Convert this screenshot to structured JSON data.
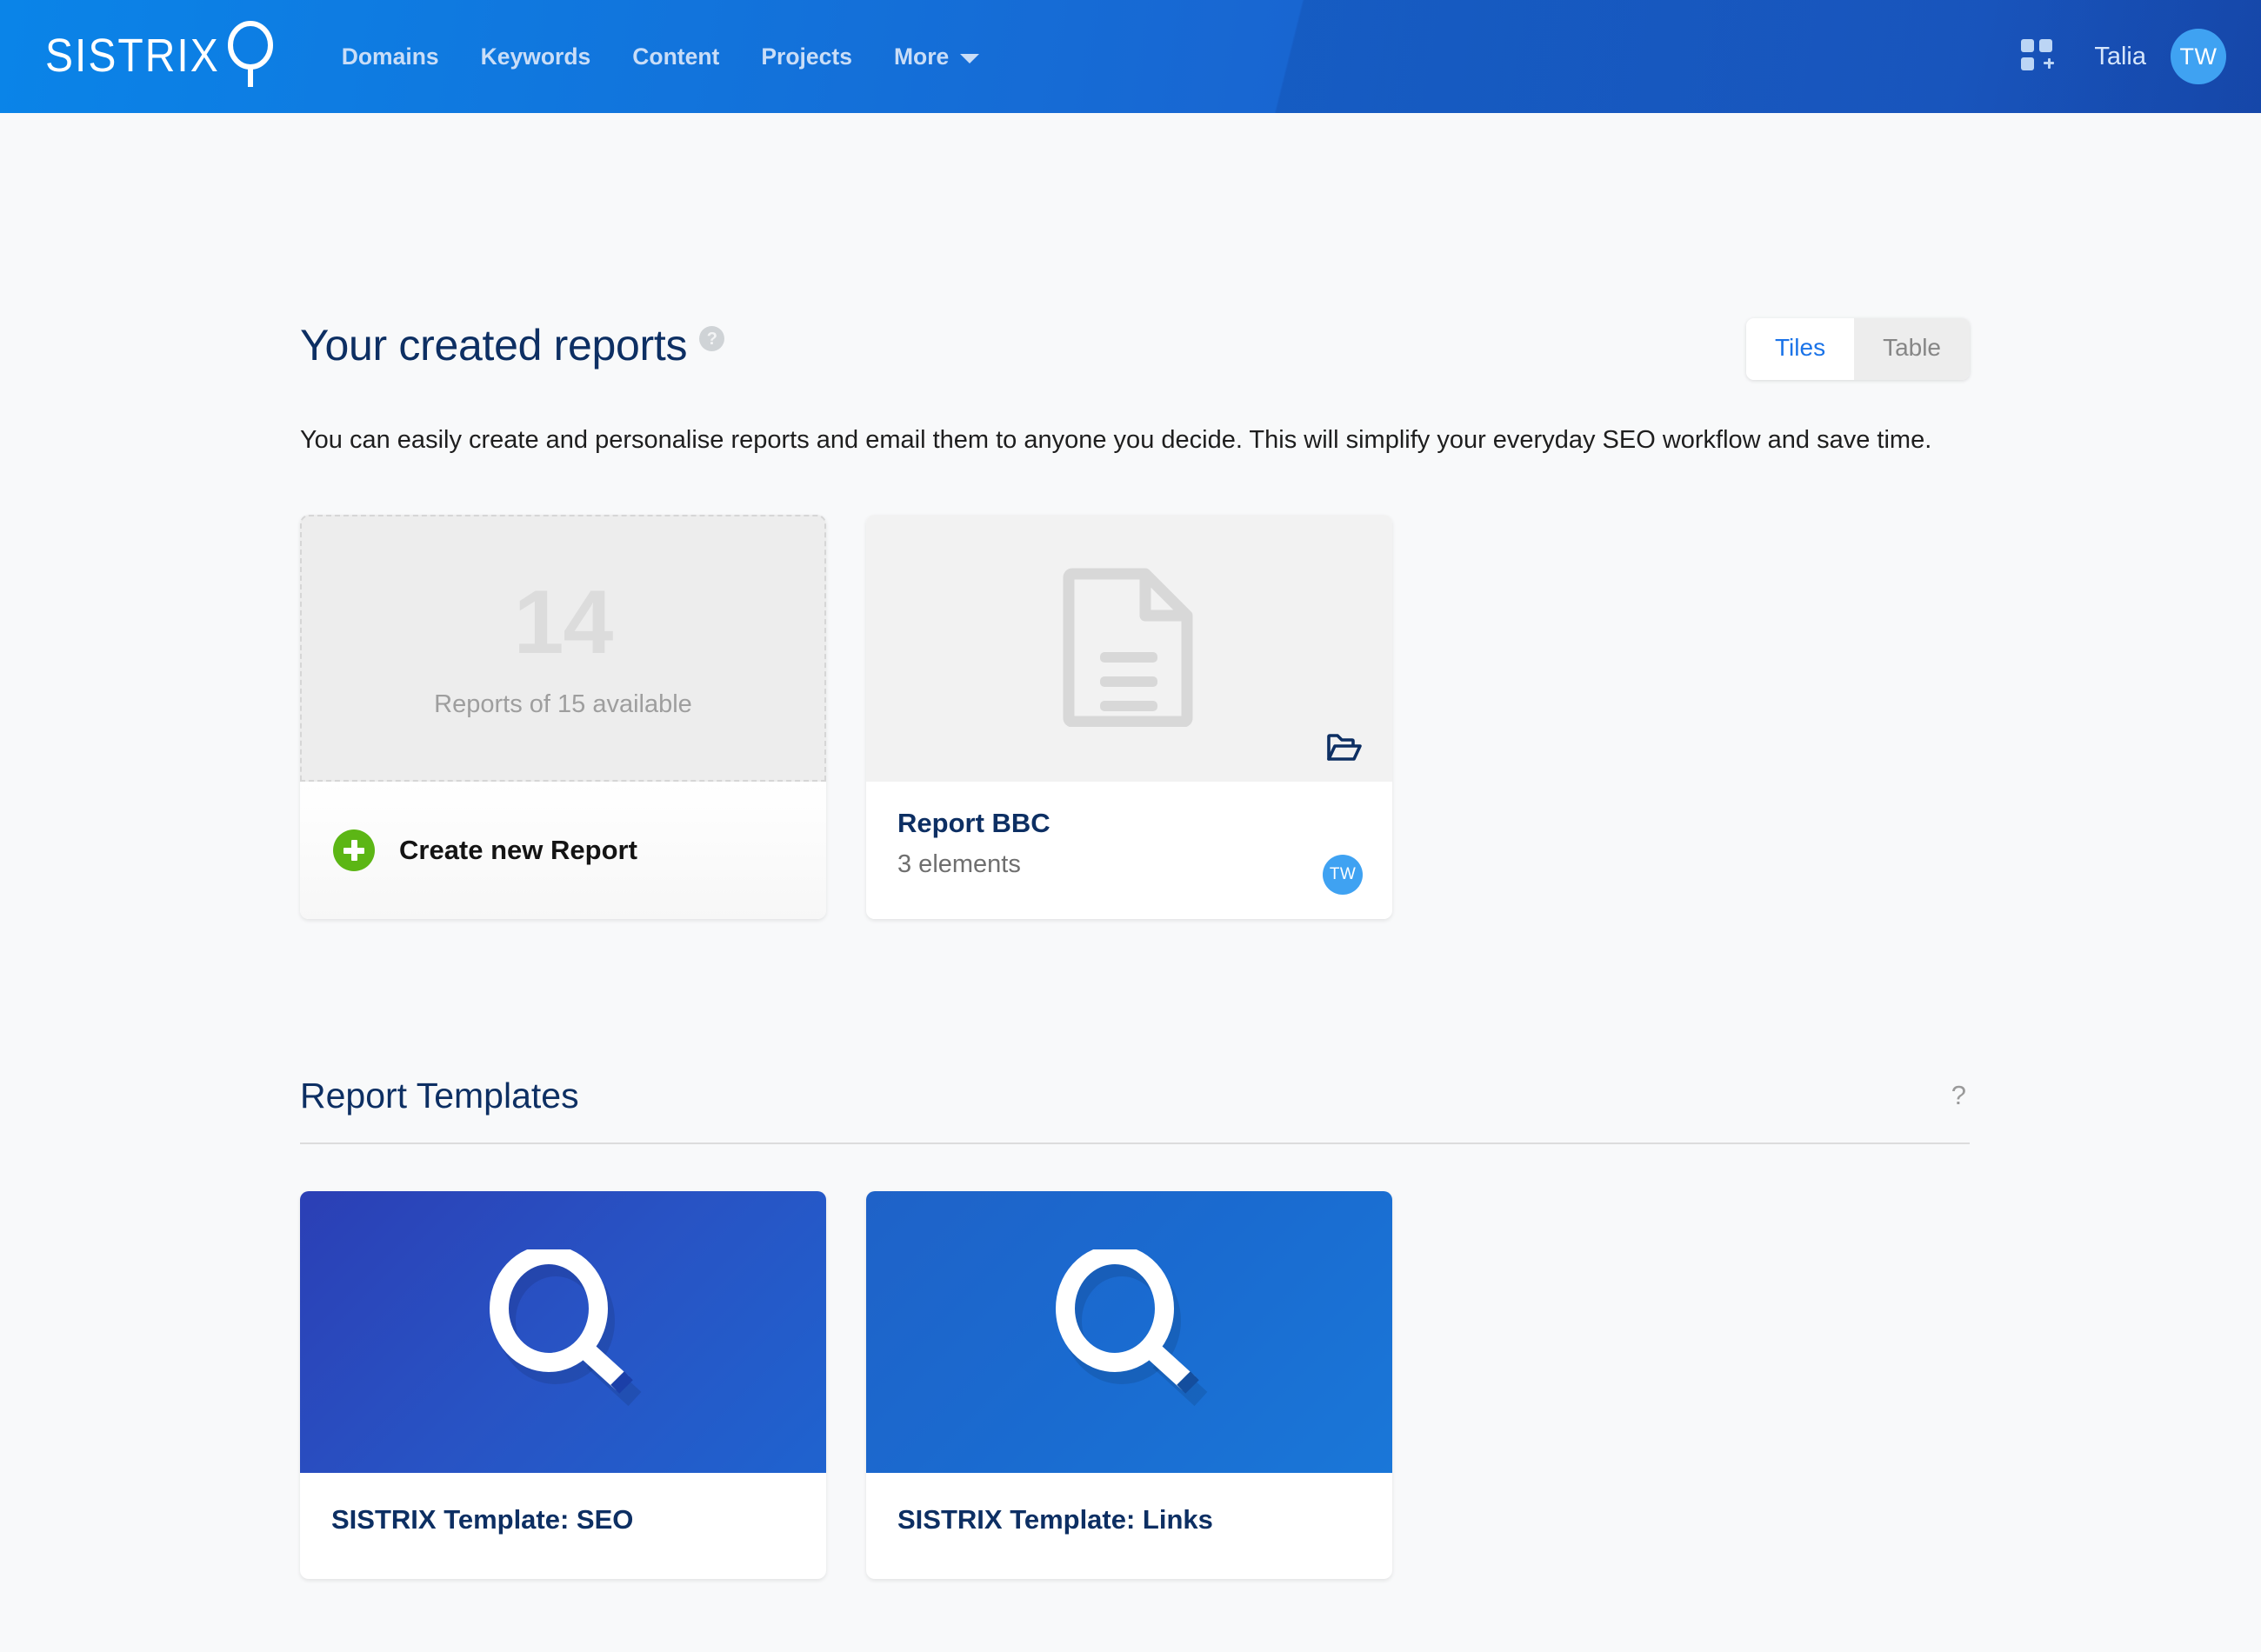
{
  "navbar": {
    "logo_text": "SISTRIX",
    "logo_icon": "magnifier-icon",
    "links": [
      {
        "label": "Domains"
      },
      {
        "label": "Keywords"
      },
      {
        "label": "Content"
      },
      {
        "label": "Projects"
      },
      {
        "label": "More"
      }
    ],
    "apps_icon": "grid-plus-icon",
    "user_name": "Talia",
    "user_initials": "TW",
    "avatar_color": "#3fa2f2"
  },
  "reports": {
    "title": "Your created reports",
    "help_icon": "question-mark-circle-icon",
    "view_toggle": {
      "tiles_label": "Tiles",
      "table_label": "Table",
      "active": "Tiles"
    },
    "intro": "You can easily create and personalise reports and email them to anyone you decide. This will simplify your everyday SEO workflow and save time.",
    "create_tile": {
      "count": "14",
      "availability_text": "Reports of 15 available",
      "create_label": "Create new Report",
      "plus_icon": "plus-circle-icon",
      "plus_color": "#5cb615"
    },
    "items": [
      {
        "name": "Report BBC",
        "elements": "3 elements",
        "thumb_icon": "document-icon",
        "folder_icon": "open-folder-icon",
        "owner_initials": "TW"
      }
    ]
  },
  "templates": {
    "title": "Report Templates",
    "help_icon": "question-mark-icon",
    "items": [
      {
        "name": "SISTRIX Template: SEO",
        "banner_icon": "magnifier-icon",
        "banner_color": "#2853c4"
      },
      {
        "name": "SISTRIX Template: Links",
        "banner_icon": "magnifier-icon",
        "banner_color": "#1a6bd0"
      }
    ]
  }
}
